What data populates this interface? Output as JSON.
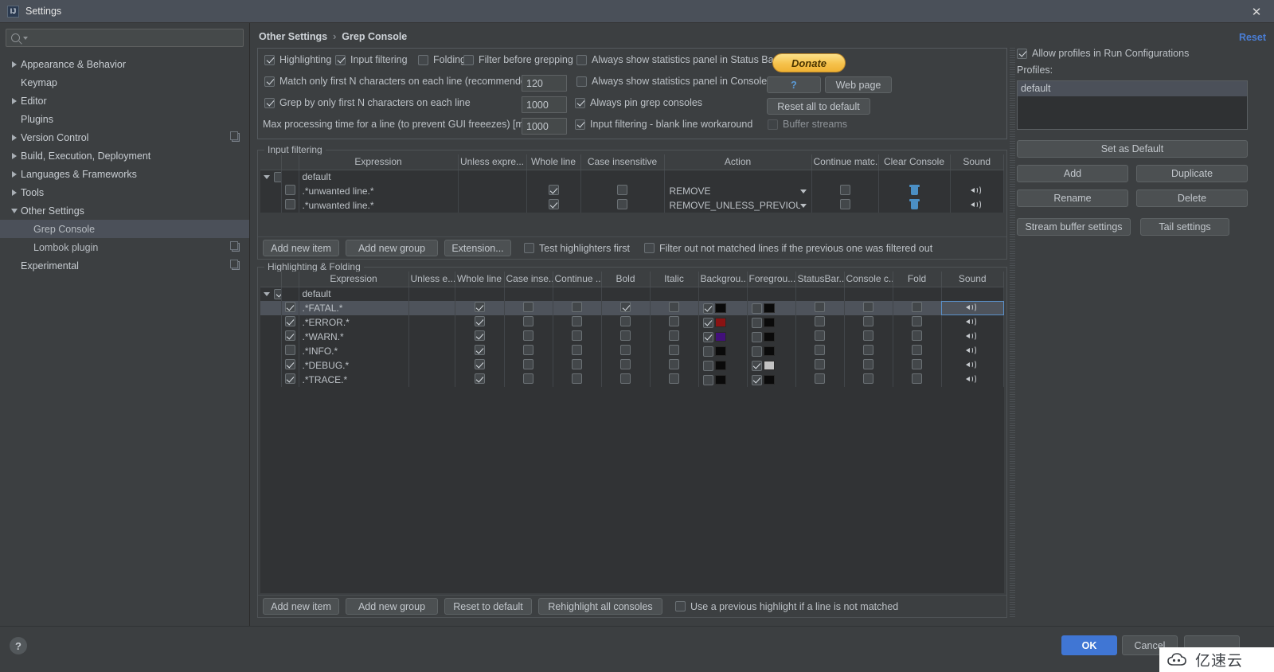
{
  "window": {
    "title": "Settings",
    "icon": "intellij-icon",
    "close_label": "✕"
  },
  "sidebar": {
    "search": {
      "placeholder": "",
      "value": ""
    },
    "items": [
      {
        "label": "Appearance & Behavior",
        "arrow": "right",
        "indent": false,
        "badge": false,
        "selected": false
      },
      {
        "label": "Keymap",
        "arrow": "none",
        "indent": false,
        "badge": false,
        "selected": false
      },
      {
        "label": "Editor",
        "arrow": "right",
        "indent": false,
        "badge": false,
        "selected": false
      },
      {
        "label": "Plugins",
        "arrow": "none",
        "indent": false,
        "badge": false,
        "selected": false
      },
      {
        "label": "Version Control",
        "arrow": "right",
        "indent": false,
        "badge": true,
        "selected": false
      },
      {
        "label": "Build, Execution, Deployment",
        "arrow": "right",
        "indent": false,
        "badge": false,
        "selected": false
      },
      {
        "label": "Languages & Frameworks",
        "arrow": "right",
        "indent": false,
        "badge": false,
        "selected": false
      },
      {
        "label": "Tools",
        "arrow": "right",
        "indent": false,
        "badge": false,
        "selected": false
      },
      {
        "label": "Other Settings",
        "arrow": "down",
        "indent": false,
        "badge": false,
        "selected": false
      },
      {
        "label": "Grep Console",
        "arrow": "none",
        "indent": true,
        "badge": false,
        "selected": true
      },
      {
        "label": "Lombok plugin",
        "arrow": "none",
        "indent": true,
        "badge": true,
        "selected": false
      },
      {
        "label": "Experimental",
        "arrow": "none",
        "indent": false,
        "badge": true,
        "selected": false
      }
    ]
  },
  "header": {
    "breadcrumb_parent": "Other Settings",
    "breadcrumb_sep": "›",
    "breadcrumb_current": "Grep Console",
    "reset_label": "Reset"
  },
  "general": {
    "highlighting": {
      "label": "Highlighting",
      "checked": true
    },
    "input_filtering": {
      "label": "Input filtering",
      "checked": true
    },
    "folding": {
      "label": "Folding",
      "checked": false
    },
    "filter_before_grepping": {
      "label": "Filter before grepping",
      "checked": false
    },
    "stats_status_bar": {
      "label": "Always show statistics panel in Status Bar",
      "checked": false
    },
    "match_first_n": {
      "label": "Match only first N characters on each line (recommended)",
      "checked": true,
      "value": "120"
    },
    "stats_console": {
      "label": "Always show statistics panel in Console",
      "checked": false
    },
    "grep_first_n": {
      "label": "Grep by only first N characters on each line",
      "checked": true,
      "value": "1000"
    },
    "pin_consoles": {
      "label": "Always pin grep consoles",
      "checked": true
    },
    "max_time": {
      "label": "Max processing time for a line (to prevent GUI freeezes) [ms]",
      "value": "1000"
    },
    "blank_line_workaround": {
      "label": "Input filtering - blank line workaround",
      "checked": true
    },
    "buffer_streams": {
      "label": "Buffer streams",
      "checked": false
    },
    "donate_label": "Donate",
    "help_label": "?",
    "webpage_label": "Web page",
    "reset_all_label": "Reset all to default"
  },
  "input_filtering": {
    "group_title": "Input filtering",
    "columns": [
      "",
      "",
      "Expression",
      "Unless expre...",
      "Whole line",
      "Case insensitive",
      "Action",
      "Continue matc...",
      "Clear Console",
      "Sound"
    ],
    "group_row": {
      "label": "default",
      "checked": false
    },
    "rows": [
      {
        "enabled": false,
        "expression": ".*unwanted line.*",
        "unless_expression": "",
        "whole_line": true,
        "case_insensitive": false,
        "action": "REMOVE",
        "continue_matching": false,
        "clear_console": "trash-icon",
        "sound": "speaker-icon"
      },
      {
        "enabled": false,
        "expression": ".*unwanted line.*",
        "unless_expression": "",
        "whole_line": true,
        "case_insensitive": false,
        "action": "REMOVE_UNLESS_PREVIOUS...",
        "continue_matching": false,
        "clear_console": "trash-icon",
        "sound": "speaker-icon"
      }
    ],
    "toolbar": {
      "add_new_item": "Add new item",
      "add_new_group": "Add new group",
      "extension": "Extension...",
      "test_highlighters_first": {
        "label": "Test highlighters first",
        "checked": false
      },
      "filter_out_not_matched": {
        "label": "Filter out not matched lines if the previous one was filtered out",
        "checked": false
      }
    }
  },
  "highlighting": {
    "group_title": "Highlighting & Folding",
    "columns": [
      "",
      "",
      "Expression",
      "Unless e...",
      "Whole line",
      "Case inse...",
      "Continue ...",
      "Bold",
      "Italic",
      "Backgrou...",
      "Foregrou...",
      "StatusBar...",
      "Console c...",
      "Fold",
      "Sound"
    ],
    "group_row": {
      "label": "default",
      "checked": true
    },
    "rows": [
      {
        "selected": true,
        "enabled": true,
        "expression": ".*FATAL.*",
        "unless_expression": "",
        "whole_line": true,
        "case_insensitive": false,
        "continue_matching": false,
        "bold": true,
        "italic": false,
        "background": {
          "checked": true,
          "color": "#0a0a0a"
        },
        "foreground": {
          "checked": false,
          "color": "#0a0a0a"
        },
        "statusbar": false,
        "console_color": false,
        "fold": false,
        "sound": "speaker-icon"
      },
      {
        "selected": false,
        "enabled": true,
        "expression": ".*ERROR.*",
        "unless_expression": "",
        "whole_line": true,
        "case_insensitive": false,
        "continue_matching": false,
        "bold": false,
        "italic": false,
        "background": {
          "checked": true,
          "color": "#8b1313"
        },
        "foreground": {
          "checked": false,
          "color": "#0a0a0a"
        },
        "statusbar": false,
        "console_color": false,
        "fold": false,
        "sound": "speaker-icon"
      },
      {
        "selected": false,
        "enabled": true,
        "expression": ".*WARN.*",
        "unless_expression": "",
        "whole_line": true,
        "case_insensitive": false,
        "continue_matching": false,
        "bold": false,
        "italic": false,
        "background": {
          "checked": true,
          "color": "#42107a"
        },
        "foreground": {
          "checked": false,
          "color": "#0a0a0a"
        },
        "statusbar": false,
        "console_color": false,
        "fold": false,
        "sound": "speaker-icon"
      },
      {
        "selected": false,
        "enabled": false,
        "expression": ".*INFO.*",
        "unless_expression": "",
        "whole_line": true,
        "case_insensitive": false,
        "continue_matching": false,
        "bold": false,
        "italic": false,
        "background": {
          "checked": false,
          "color": "#0a0a0a"
        },
        "foreground": {
          "checked": false,
          "color": "#0a0a0a"
        },
        "statusbar": false,
        "console_color": false,
        "fold": false,
        "sound": "speaker-icon"
      },
      {
        "selected": false,
        "enabled": true,
        "expression": ".*DEBUG.*",
        "unless_expression": "",
        "whole_line": true,
        "case_insensitive": false,
        "continue_matching": false,
        "bold": false,
        "italic": false,
        "background": {
          "checked": false,
          "color": "#0a0a0a"
        },
        "foreground": {
          "checked": true,
          "color": "#c3c3c3"
        },
        "statusbar": false,
        "console_color": false,
        "fold": false,
        "sound": "speaker-icon"
      },
      {
        "selected": false,
        "enabled": true,
        "expression": ".*TRACE.*",
        "unless_expression": "",
        "whole_line": true,
        "case_insensitive": false,
        "continue_matching": false,
        "bold": false,
        "italic": false,
        "background": {
          "checked": false,
          "color": "#0a0a0a"
        },
        "foreground": {
          "checked": true,
          "color": "#0a0a0a"
        },
        "statusbar": false,
        "console_color": false,
        "fold": false,
        "sound": "speaker-icon"
      }
    ],
    "toolbar": {
      "add_new_item": "Add new item",
      "add_new_group": "Add new group",
      "reset_to_default": "Reset to default",
      "rehighlight_all": "Rehighlight all consoles",
      "use_previous_highlight": {
        "label": "Use a previous highlight if a line is not matched",
        "checked": false
      }
    }
  },
  "profiles": {
    "allow_in_run_configs": {
      "label": "Allow profiles in Run Configurations",
      "checked": true
    },
    "profiles_label": "Profiles:",
    "items": [
      {
        "label": "default",
        "selected": true
      }
    ],
    "set_as_default": "Set as Default",
    "add": "Add",
    "duplicate": "Duplicate",
    "rename": "Rename",
    "delete": "Delete",
    "stream_buffer_settings": "Stream buffer settings",
    "tail_settings": "Tail settings"
  },
  "footer": {
    "help": "?",
    "ok": "OK",
    "cancel": "Cancel",
    "apply": ""
  },
  "watermark": {
    "text": "亿速云"
  }
}
